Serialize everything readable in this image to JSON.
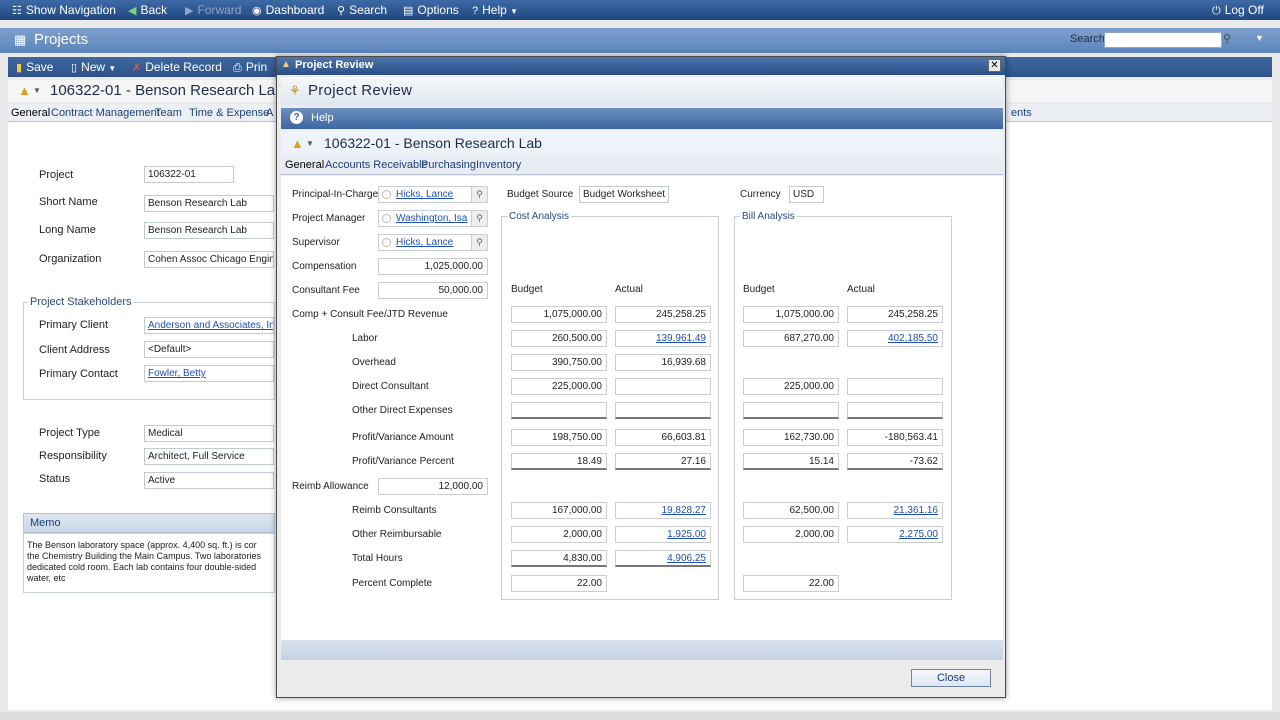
{
  "topnav": {
    "show_navigation": "Show Navigation",
    "back": "Back",
    "forward": "Forward",
    "dashboard": "Dashboard",
    "search": "Search",
    "options": "Options",
    "help": "Help",
    "logoff": "Log Off"
  },
  "projects_bar": {
    "title": "Projects",
    "search_label": "Search",
    "search_value": ""
  },
  "toolbar": {
    "save": "Save",
    "new": "New",
    "delete_record": "Delete Record",
    "print": "Prin"
  },
  "record": {
    "title": "106322-01 - Benson Research Lab"
  },
  "main_tabs": [
    "General",
    "Contract Management",
    "Team",
    "Time & Expense",
    "A",
    "ents"
  ],
  "main_form": {
    "project_label": "Project",
    "project_value": "106322-01",
    "short_name_label": "Short Name",
    "short_name_value": "Benson Research Lab",
    "long_name_label": "Long Name",
    "long_name_value": "Benson Research Lab",
    "organization_label": "Organization",
    "organization_value": "Cohen Assoc Chicago Enginee",
    "stakeholders_title": "Project Stakeholders",
    "primary_client_label": "Primary Client",
    "primary_client_value": "Anderson and Associates, Inc",
    "client_address_label": "Client Address",
    "client_address_value": "<Default>",
    "primary_contact_label": "Primary Contact",
    "primary_contact_value": "Fowler, Betty",
    "project_type_label": "Project Type",
    "project_type_value": "Medical",
    "responsibility_label": "Responsibility",
    "responsibility_value": "Architect, Full Service",
    "status_label": "Status",
    "status_value": "Active",
    "memo_title": "Memo",
    "memo_lines": [
      "The Benson laboratory space (approx. 4,400 sq. ft.) is cor",
      "the Chemistry Building the Main Campus.  Two laboratories",
      "dedicated cold room.  Each lab contains four double-sided",
      "water, etc"
    ]
  },
  "dialog": {
    "window_title": "Project Review",
    "header_title": "Project Review",
    "help": "Help",
    "record_title": "106322-01 - Benson Research Lab",
    "tabs": [
      "General",
      "Accounts Receivable",
      "Purchasing",
      "Inventory"
    ],
    "principal_label": "Principal-In-Charge",
    "principal_value": "Hicks, Lance",
    "pm_label": "Project Manager",
    "pm_value": "Washington, Isa",
    "supervisor_label": "Supervisor",
    "supervisor_value": "Hicks, Lance",
    "compensation_label": "Compensation",
    "compensation_value": "1,025,000.00",
    "consultant_fee_label": "Consultant Fee",
    "consultant_fee_value": "50,000.00",
    "budget_source_label": "Budget Source",
    "budget_source_value": "Budget Worksheet",
    "currency_label": "Currency",
    "currency_value": "USD",
    "cost_analysis": "Cost Analysis",
    "bill_analysis": "Bill Analysis",
    "col_budget": "Budget",
    "col_actual": "Actual",
    "reimb_allowance_label": "Reimb Allowance",
    "reimb_allowance_value": "12,000.00",
    "rows": [
      {
        "label": "Comp + Consult Fee/JTD Revenue",
        "cb": "1,075,000.00",
        "ca": "245,258.25",
        "bb": "1,075,000.00",
        "ba": "245,258.25"
      },
      {
        "label": "Labor",
        "cb": "260,500.00",
        "ca": "139,961.49",
        "bb": "687,270.00",
        "ba": "402,185.50"
      },
      {
        "label": "Overhead",
        "cb": "390,750.00",
        "ca": "16,939.68",
        "bb": "",
        "ba": ""
      },
      {
        "label": "Direct Consultant",
        "cb": "225,000.00",
        "ca": "",
        "bb": "225,000.00",
        "ba": ""
      },
      {
        "label": "Other Direct Expenses",
        "cb": "",
        "ca": "",
        "bb": "",
        "ba": ""
      },
      {
        "label": "Profit/Variance Amount",
        "cb": "198,750.00",
        "ca": "66,603.81",
        "bb": "162,730.00",
        "ba": "-180,563.41"
      },
      {
        "label": "Profit/Variance Percent",
        "cb": "18.49",
        "ca": "27.16",
        "bb": "15.14",
        "ba": "-73.62"
      },
      {
        "label": "Reimb Consultants",
        "cb": "167,000.00",
        "ca": "19,828.27",
        "bb": "62,500.00",
        "ba": "21,361.16"
      },
      {
        "label": "Other Reimbursable",
        "cb": "2,000.00",
        "ca": "1,925.00",
        "bb": "2,000.00",
        "ba": "2,275.00"
      },
      {
        "label": "Total Hours",
        "cb": "4,830.00",
        "ca": "4,906.25",
        "bb": "",
        "ba": ""
      },
      {
        "label": "Percent Complete",
        "cb": "22.00",
        "ca": "",
        "bb": "22.00",
        "ba": ""
      }
    ],
    "close": "Close"
  },
  "colors": {
    "nav_blue": "#21477f",
    "link": "#1f4fb5",
    "accent": "#3c65a0"
  }
}
